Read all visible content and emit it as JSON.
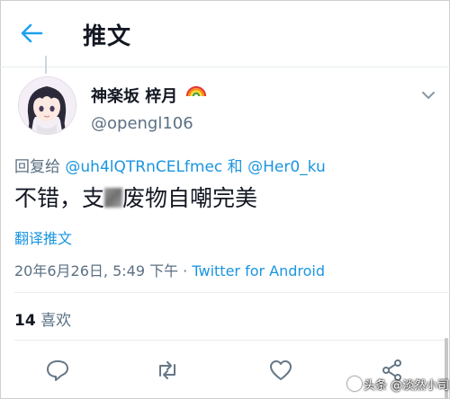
{
  "header": {
    "title": "推文"
  },
  "tweet": {
    "display_name": "神楽坂 梓月",
    "handle": "@opengl106",
    "reply_prefix": "回复给 ",
    "reply_mention_1": "@uh4lQTRnCELfmec",
    "reply_and": " 和 ",
    "reply_mention_2": "@Her0_ku",
    "text_before_blur": "不错，支",
    "text_after_blur": "废物自嘲完美",
    "translate_label": "翻译推文",
    "timestamp": "20年6月26日, 5:49 下午",
    "separator": " · ",
    "source": "Twitter for Android",
    "like_count": "14",
    "like_label": " 喜欢"
  },
  "watermark": {
    "text": "头条 @淡然小司"
  },
  "icons": {
    "back": "arrow-left-icon",
    "more": "chevron-down-icon",
    "reply": "reply-bubble-icon",
    "retweet": "retweet-icon",
    "like": "heart-icon",
    "share": "share-icon",
    "name_emoji": "rainbow-icon"
  },
  "colors": {
    "link": "#1b95e0",
    "secondary": "#5b7083",
    "text": "#141823"
  }
}
